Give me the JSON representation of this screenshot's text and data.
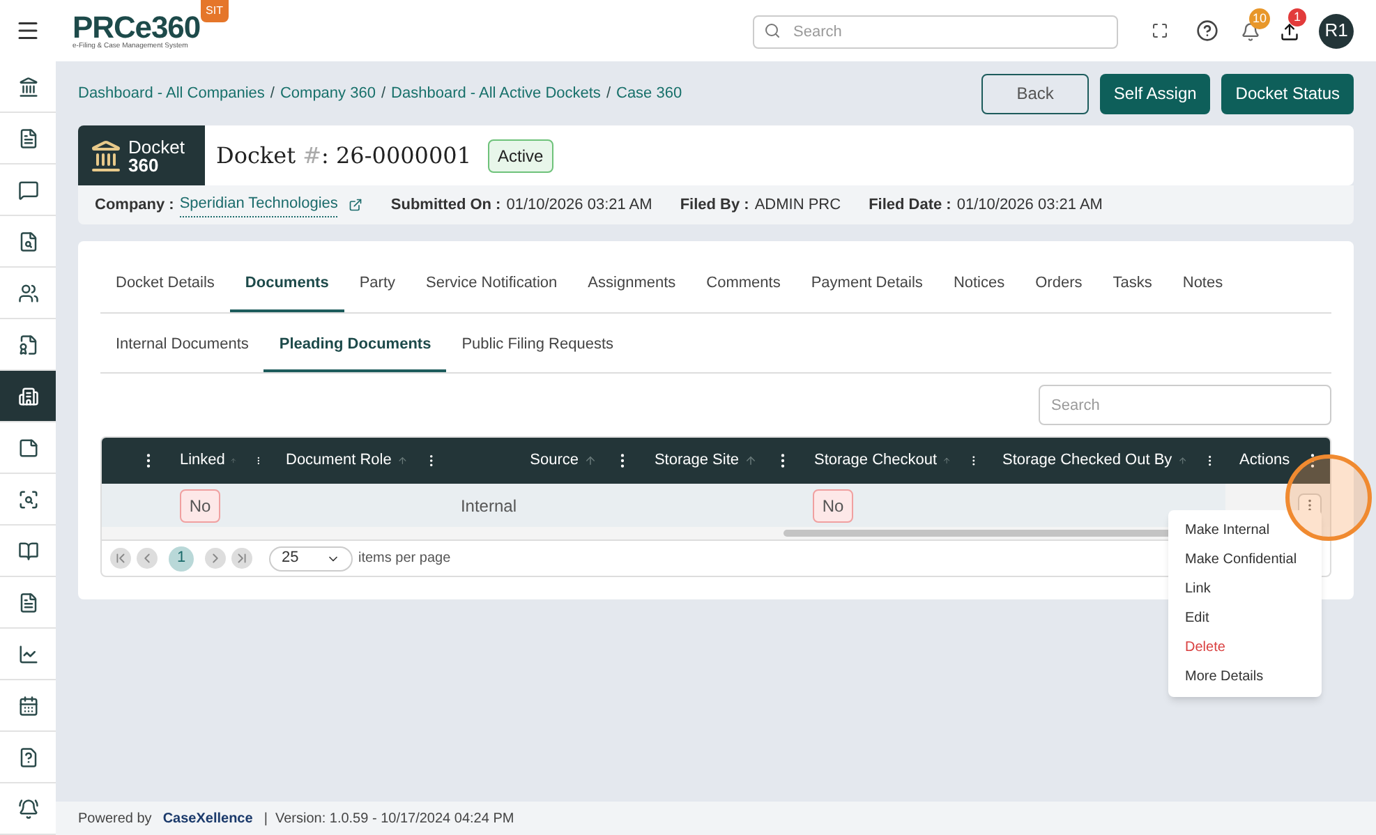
{
  "header": {
    "logo": "PRCe360",
    "logo_subtitle": "e-Filing & Case Management System",
    "env_badge": "SIT",
    "search": {
      "placeholder": "Search"
    },
    "notifications_count": "10",
    "uploads_count": "1",
    "avatar": "R1"
  },
  "sidebar": {
    "items": [
      {
        "selected": false
      },
      {
        "selected": false
      },
      {
        "selected": false
      },
      {
        "selected": false
      },
      {
        "selected": false
      },
      {
        "selected": false
      },
      {
        "selected": true
      },
      {
        "selected": false
      },
      {
        "selected": false
      },
      {
        "selected": false
      },
      {
        "selected": false
      },
      {
        "selected": false
      },
      {
        "selected": false
      },
      {
        "selected": false
      },
      {
        "selected": false
      }
    ]
  },
  "breadcrumb": [
    {
      "kind": "link",
      "text": "Dashboard - All Companies"
    },
    {
      "kind": "separator",
      "text": "/"
    },
    {
      "kind": "link",
      "text": "Company 360"
    },
    {
      "kind": "separator",
      "text": "/"
    },
    {
      "kind": "link",
      "text": "Dashboard - All Active Dockets"
    },
    {
      "kind": "separator",
      "text": "/"
    },
    {
      "kind": "link",
      "text": "Case 360"
    }
  ],
  "actions": [
    {
      "label": "Back",
      "kind": "outline"
    },
    {
      "label": "Self Assign",
      "kind": "solid"
    },
    {
      "label": "Docket Status",
      "kind": "solid"
    }
  ],
  "docket": {
    "badge_title": "Docket",
    "badge_number": "360",
    "title": "Docket",
    "hash": "#",
    "number": ": 26-0000001",
    "status": "Active"
  },
  "info": [
    {
      "label": "Company :",
      "value": "Speridian Technologies",
      "kind": "link"
    },
    {
      "label": "Submitted On :",
      "value": "01/10/2026 03:21 AM",
      "kind": "text"
    },
    {
      "label": "Filed By :",
      "value": "ADMIN PRC",
      "kind": "text"
    },
    {
      "label": "Filed Date :",
      "value": "01/10/2026 03:21 AM",
      "kind": "text"
    }
  ],
  "tabs": [
    {
      "label": "Docket Details",
      "selected": false
    },
    {
      "label": "Documents",
      "selected": true
    },
    {
      "label": "Party",
      "selected": false
    },
    {
      "label": "Service Notification",
      "selected": false
    },
    {
      "label": "Assignments",
      "selected": false
    },
    {
      "label": "Comments",
      "selected": false
    },
    {
      "label": "Payment Details",
      "selected": false
    },
    {
      "label": "Notices",
      "selected": false
    },
    {
      "label": "Orders",
      "selected": false
    },
    {
      "label": "Tasks",
      "selected": false
    },
    {
      "label": "Notes",
      "selected": false
    }
  ],
  "subtabs": [
    {
      "label": "Internal Documents",
      "selected": false
    },
    {
      "label": "Pleading Documents",
      "selected": true
    },
    {
      "label": "Public Filing Requests",
      "selected": false
    }
  ],
  "table_search": {
    "placeholder": "Search"
  },
  "table": {
    "columns": [
      "",
      "Linked",
      "Document Role",
      "Source",
      "Storage Site",
      "Storage Checkout",
      "Storage Checked Out By",
      "Actions"
    ],
    "rows": [
      [
        "",
        "No",
        "",
        "Internal",
        "",
        "No",
        "",
        ""
      ]
    ]
  },
  "pager": {
    "pages": [
      {
        "label": "1",
        "selected": true
      }
    ],
    "page_size": "25",
    "page_size_label": "items per page"
  },
  "row_menu": [
    {
      "label": "Make Internal",
      "kind": "normal"
    },
    {
      "label": "Make Confidential",
      "kind": "normal"
    },
    {
      "label": "Link",
      "kind": "normal"
    },
    {
      "label": "Edit",
      "kind": "normal"
    },
    {
      "label": "Delete",
      "kind": "danger"
    },
    {
      "label": "More Details",
      "kind": "normal"
    }
  ],
  "footer": {
    "powered_by": "Powered by",
    "brand": "CaseXellence",
    "version": "|  Version: 1.0.59 - 10/17/2024 04:24 PM"
  }
}
